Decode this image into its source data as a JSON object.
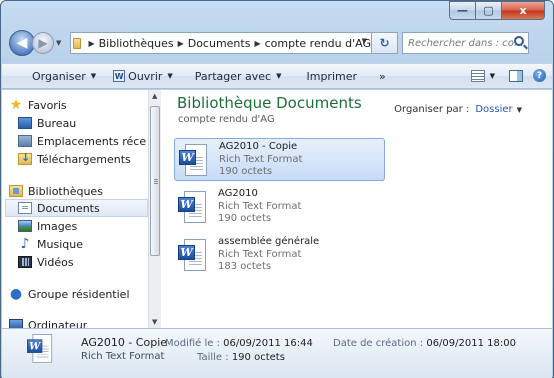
{
  "window": {
    "caption_buttons": {
      "minimize": "—",
      "maximize": "▢",
      "close": "x"
    }
  },
  "address_bar": {
    "crumbs": [
      "Bibliothèques",
      "Documents",
      "compte rendu d'AG"
    ],
    "search_placeholder": "Rechercher dans : co..."
  },
  "toolbar": {
    "organize": "Organiser",
    "open": "Ouvrir",
    "share": "Partager avec",
    "print": "Imprimer",
    "more": "»"
  },
  "nav": {
    "favorites_header": "Favoris",
    "favorites": [
      "Bureau",
      "Emplacements réce",
      "Téléchargements"
    ],
    "libraries_header": "Bibliothèques",
    "libraries": [
      "Documents",
      "Images",
      "Musique",
      "Vidéos"
    ],
    "selected": "Documents",
    "homegroup": "Groupe résidentiel",
    "computer_partial": "Ordinateur"
  },
  "content": {
    "library_title": "Bibliothèque Documents",
    "library_subtitle": "compte rendu d'AG",
    "arrange_label": "Organiser par :",
    "arrange_value": "Dossier",
    "files": [
      {
        "name": "AG2010 - Copie",
        "type": "Rich Text Format",
        "size": "190 octets",
        "selected": true
      },
      {
        "name": "AG2010",
        "type": "Rich Text Format",
        "size": "190 octets",
        "selected": false
      },
      {
        "name": "assemblée générale",
        "type": "Rich Text Format",
        "size": "183 octets",
        "selected": false
      }
    ]
  },
  "details": {
    "name": "AG2010 - Copie",
    "type": "Rich Text Format",
    "modified_label": "Modifié le :",
    "modified_value": "06/09/2011 16:44",
    "size_label": "Taille :",
    "size_value": "190 octets",
    "created_label": "Date de création :",
    "created_value": "06/09/2011 18:00"
  },
  "icons": {
    "word_letter": "W"
  }
}
